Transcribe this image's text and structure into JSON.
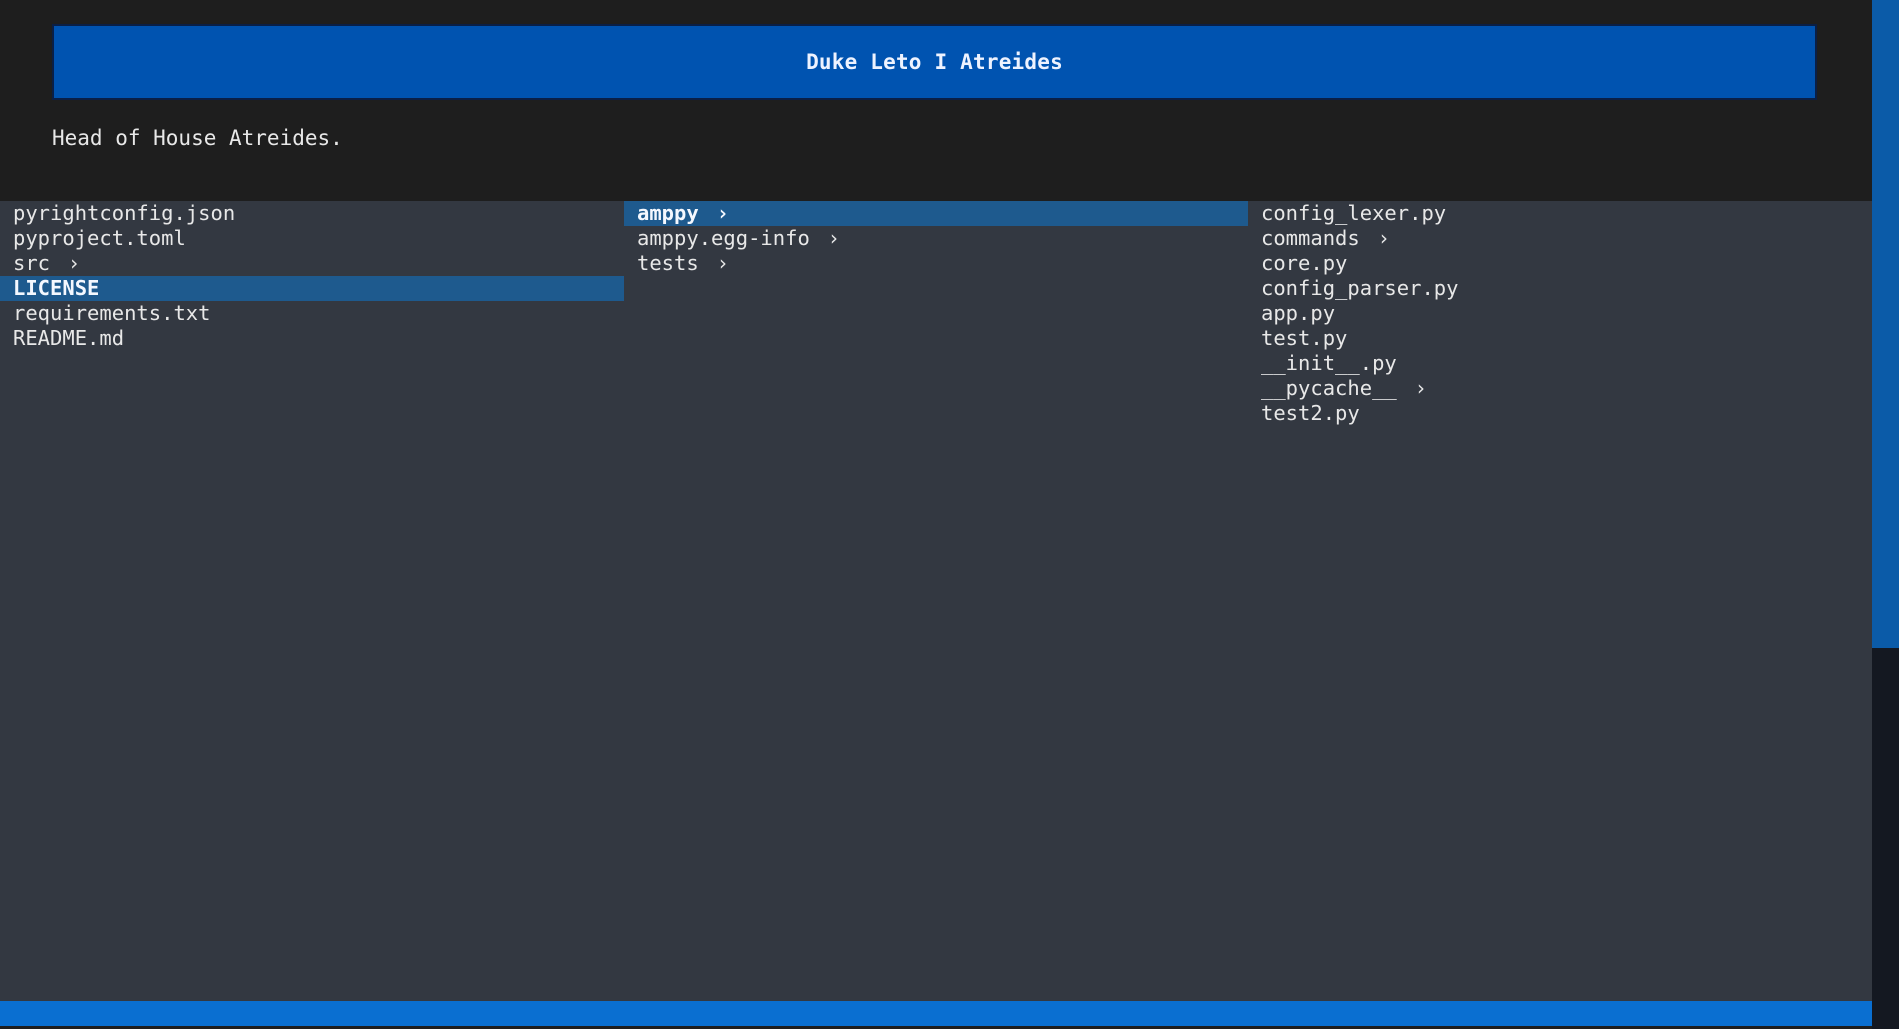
{
  "header": {
    "title": "Duke Leto I Atreides",
    "description": "Head of House Atreides."
  },
  "columns": [
    {
      "items": [
        {
          "label": "pyrightconfig.json",
          "dir": false,
          "selected": false
        },
        {
          "label": "pyproject.toml",
          "dir": false,
          "selected": false
        },
        {
          "label": "src",
          "dir": true,
          "selected": false
        },
        {
          "label": "LICENSE",
          "dir": false,
          "selected": true
        },
        {
          "label": "requirements.txt",
          "dir": false,
          "selected": false
        },
        {
          "label": "README.md",
          "dir": false,
          "selected": false
        }
      ]
    },
    {
      "items": [
        {
          "label": "amppy",
          "dir": true,
          "selected": true
        },
        {
          "label": "amppy.egg-info",
          "dir": true,
          "selected": false
        },
        {
          "label": "tests",
          "dir": true,
          "selected": false
        }
      ]
    },
    {
      "items": [
        {
          "label": "config_lexer.py",
          "dir": false,
          "selected": false
        },
        {
          "label": "commands",
          "dir": true,
          "selected": false
        },
        {
          "label": "core.py",
          "dir": false,
          "selected": false
        },
        {
          "label": "config_parser.py",
          "dir": false,
          "selected": false
        },
        {
          "label": "app.py",
          "dir": false,
          "selected": false
        },
        {
          "label": "test.py",
          "dir": false,
          "selected": false
        },
        {
          "label": "__init__.py",
          "dir": false,
          "selected": false
        },
        {
          "label": "__pycache__",
          "dir": true,
          "selected": false
        },
        {
          "label": "test2.py",
          "dir": false,
          "selected": false
        }
      ]
    }
  ],
  "icons": {
    "chevron": "›"
  },
  "colors": {
    "title_bar": "#0053b0",
    "selection": "#1e5a8e",
    "panel_bg": "#333841",
    "footer": "#0a6fd1",
    "scroll_thumb": "#0b5ba8"
  }
}
